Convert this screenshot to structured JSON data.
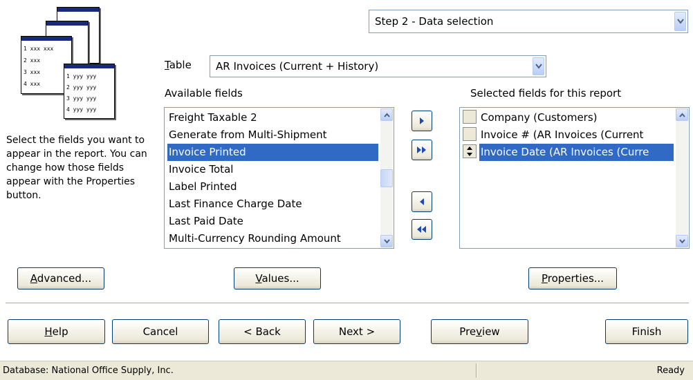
{
  "step_select": {
    "value": "Step 2 - Data selection"
  },
  "table": {
    "label_access": "T",
    "label_rest": "able",
    "value": "AR Invoices (Current + History)"
  },
  "available": {
    "label": "Available fields",
    "items": [
      "Freight Taxable 2",
      "Generate from Multi-Shipment",
      "Invoice Printed",
      "Invoice Total",
      "Label Printed",
      "Last Finance Charge Date",
      "Last Paid Date",
      "Multi-Currency Rounding Amount"
    ],
    "selected_index": 2
  },
  "selected": {
    "label": "Selected fields for this report",
    "items": [
      "Company (Customers)",
      "Invoice # (AR Invoices (Current",
      "Invoice Date (AR Invoices (Curre"
    ],
    "selected_index": 2
  },
  "instructions": "Select the fields you want to appear in the report. You can change how those fields appear with the Properties button.",
  "sheet_rows_left": [
    "1 xxx xxx",
    "2 xxx",
    "3 xxx",
    "4 xxx"
  ],
  "sheet_rows_right": [
    "1 yyy yyy",
    "2 yyy yyy",
    "3 yyy yyy",
    "4 yyy yyy"
  ],
  "buttons": {
    "advanced": {
      "access": "A",
      "rest": "dvanced..."
    },
    "values": {
      "access": "V",
      "rest": "alues..."
    },
    "properties": {
      "access": "P",
      "rest": "roperties..."
    },
    "help": {
      "access": "H",
      "rest": "elp"
    },
    "cancel": "Cancel",
    "back": "< Back",
    "next": "Next >",
    "preview_pre": "Pre",
    "preview_access": "v",
    "preview_post": "iew",
    "finish": "Finish"
  },
  "status": {
    "left": "Database: National Office Supply, Inc.",
    "right": "Ready"
  },
  "colors": {
    "selection": "#316ac5",
    "button_border": "#003c74",
    "status_bg": "#ece9d8"
  }
}
